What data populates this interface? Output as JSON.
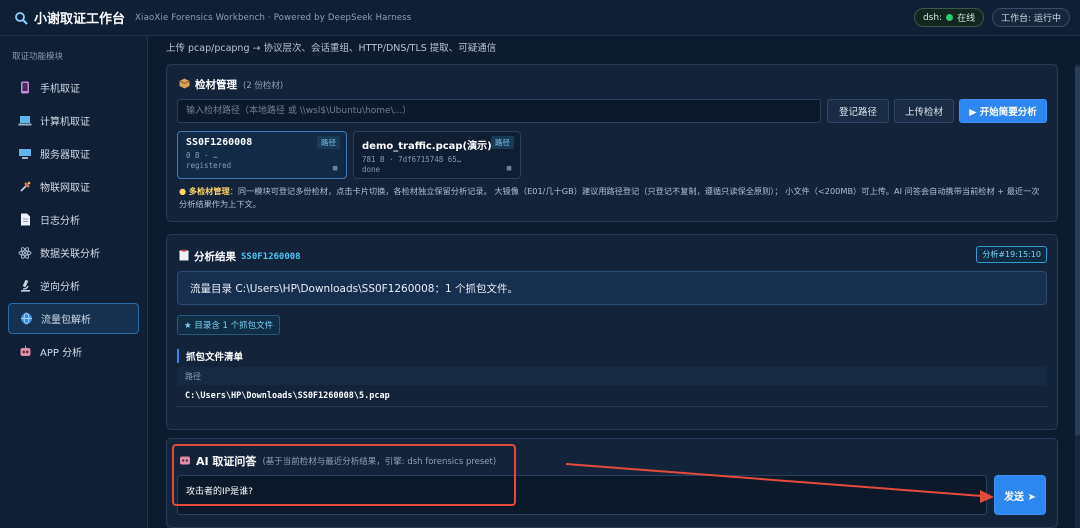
{
  "header": {
    "title": "小谢取证工作台",
    "subtitle": "XiaoXie Forensics Workbench · Powered by DeepSeek Harness",
    "status_label": "dsh:",
    "status_value": "在线",
    "workspace_status": "工作台: 运行中"
  },
  "sidebar": {
    "section_title": "取证功能模块",
    "items": [
      {
        "label": "手机取证",
        "icon": "phone-icon"
      },
      {
        "label": "计算机取证",
        "icon": "laptop-icon"
      },
      {
        "label": "服务器取证",
        "icon": "server-icon"
      },
      {
        "label": "物联网取证",
        "icon": "iot-icon"
      },
      {
        "label": "日志分析",
        "icon": "document-icon"
      },
      {
        "label": "数据关联分析",
        "icon": "atom-icon"
      },
      {
        "label": "逆向分析",
        "icon": "microscope-icon"
      },
      {
        "label": "流量包解析",
        "icon": "globe-icon",
        "active": true
      },
      {
        "label": "APP 分析",
        "icon": "robot-icon"
      }
    ]
  },
  "main": {
    "intro": "上传 pcap/pcapng → 协议层次、会话重组、HTTP/DNS/TLS 提取、可疑通信",
    "evidence": {
      "title": "检材管理",
      "count": "(2 份检材)",
      "input_placeholder": "输入检材路径（本地路径 或 \\\\wsl$\\Ubuntu\\home\\...）",
      "register_label": "登记路径",
      "upload_label": "上传检材",
      "analyze_label": "▶ 开始简要分析",
      "cards": [
        {
          "name": "SS0F1260008",
          "tag": "路径",
          "meta1": "0 B · …",
          "meta2": "registered",
          "mark": "◼"
        },
        {
          "name": "demo_traffic.pcap(演示)",
          "tag": "路径",
          "meta1": "781 B · 7df6715748 65…",
          "meta2": "done",
          "mark": "◼"
        }
      ],
      "tip_bold": "多检材管理",
      "tip_text": "：同一模块可登记多份检材，点击卡片切换，各检材独立保留分析记录。 大镜像（E01/几十GB）建议用路径登记（只登记不复制，遵循只读保全原则）； 小文件（<200MB）可上传。AI 问答会自动携带当前检材 + 最近一次分析结果作为上下文。"
    },
    "result": {
      "title": "分析结果",
      "case_id": "SS0F1260008",
      "time_badge": "分析#19:15:10",
      "summary": "流量目录 C:\\Users\\HP\\Downloads\\SS0F1260008：1 个抓包文件。",
      "count_tag": "★ 目录含 1 个抓包文件",
      "list_title": "抓包文件清单",
      "table_header": "路径",
      "rows": [
        "C:\\Users\\HP\\Downloads\\SS0F1260008\\5.pcap"
      ]
    },
    "ai": {
      "title": "AI 取证问答",
      "subtitle": "(基于当前检材与最近分析结果，引擎: dsh forensics preset)",
      "question": "攻击者的IP是谁?",
      "send_label": "发送 ➤"
    }
  },
  "colors": {
    "accent": "#2e86f0",
    "annotation": "#e54b3c",
    "online": "#2ecc71"
  }
}
